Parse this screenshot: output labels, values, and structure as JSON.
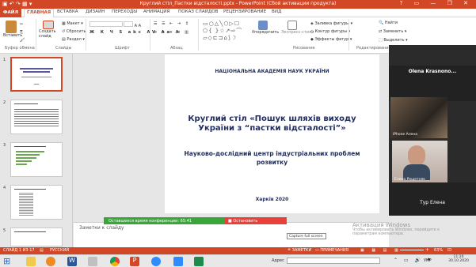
{
  "window": {
    "title": "Круглий стіл_Пастки відсталості.pptx - PowerPoint (Сбой активации продукта)",
    "controls": [
      "?",
      "▭",
      "—",
      "❐",
      "✕"
    ]
  },
  "tabs": [
    {
      "label": "ФАЙЛ"
    },
    {
      "label": "ГЛАВНАЯ"
    },
    {
      "label": "ВСТАВКА"
    },
    {
      "label": "ДИЗАЙН"
    },
    {
      "label": "ПЕРЕХОДЫ"
    },
    {
      "label": "АНИМАЦИЯ"
    },
    {
      "label": "ПОКАЗ СЛАЙДОВ"
    },
    {
      "label": "РЕЦЕНЗИРОВАНИЕ"
    },
    {
      "label": "ВИД"
    }
  ],
  "ribbon": {
    "paste": "Вставить",
    "create_slide": "Создать слайд",
    "layout": "Макет",
    "reset": "Сбросить",
    "section": "Раздел",
    "arrange": "Упорядочить",
    "quick_styles": "Экспресс-стили",
    "shape_fill": "Заливка фигуры",
    "shape_outline": "Контур фигуры",
    "shape_effects": "Эффекты фигур",
    "find": "Найти",
    "replace": "Заменить",
    "select": "Выделить",
    "groups": {
      "clipboard": "Буфер обмена",
      "slides": "Слайды",
      "font": "Шрифт",
      "paragraph": "Абзац",
      "drawing": "Рисование",
      "editing": "Редактирование"
    }
  },
  "thumbnails": [
    {
      "num": "1"
    },
    {
      "num": "2"
    },
    {
      "num": "3"
    },
    {
      "num": "4"
    },
    {
      "num": "5"
    }
  ],
  "slide": {
    "org": "НАЦІОНАЛЬНА АКАДЕМІЯ НАУК УКРАЇНИ",
    "title_line1": "Круглий стіл «Пошук шляхів виходу",
    "title_line2": "України з “пастки відсталості”»",
    "subtitle_line1": "Науково-дослідний центр індустріальних проблем",
    "subtitle_line2": "розвитку",
    "place_date": "Харків 2020"
  },
  "notes_placeholder": "Заметки к слайду",
  "conference_bar": {
    "remaining": "Оставшееся время конференции: 65:41",
    "stop": "Остановить демонстрацию"
  },
  "capture_tooltip": "Capture full screen",
  "zoom_panel": {
    "participant1": "Olena  Krasnono...",
    "participant2": "iPhone Алена",
    "participant3": "Елена Решетняк",
    "participant4": "Тур Елена"
  },
  "activation": {
    "line1": "Активация Windows",
    "line2": "Чтобы активировать Windows, перейдите к",
    "line3": "параметрам компьютера."
  },
  "status": {
    "slide_info": "СЛАЙД 1 ИЗ 17",
    "lang": "РУССКИЙ",
    "notes": "ЗАМЕТКИ",
    "comments": "ПРИМЕЧАНИЯ",
    "zoom": "63%"
  },
  "taskbar": {
    "address_label": "Адрес",
    "lang": "УКР",
    "time": "11:20",
    "date": "30.10.2020"
  }
}
